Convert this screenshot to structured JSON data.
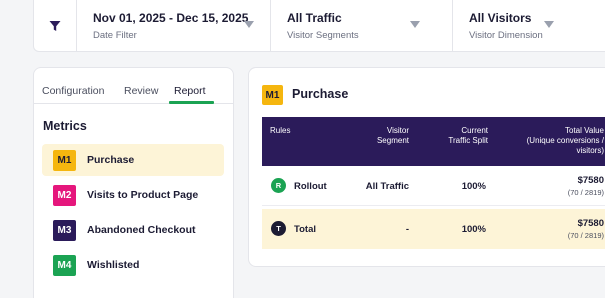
{
  "filters": [
    {
      "value": "Nov 01, 2025 - Dec 15, 2025",
      "label": "Date Filter"
    },
    {
      "value": "All Traffic",
      "label": "Visitor Segments"
    },
    {
      "value": "All Visitors",
      "label": "Visitor Dimension"
    }
  ],
  "tabs": [
    "Configuration",
    "Review",
    "Report"
  ],
  "active_tab": "Report",
  "metrics_title": "Metrics",
  "metrics": [
    {
      "code": "M1",
      "label": "Purchase",
      "color": "#f5b60f",
      "text_color": "#1c1b33",
      "active": true
    },
    {
      "code": "M2",
      "label": "Visits to Product Page",
      "color": "#e5167c",
      "text_color": "#ffffff",
      "active": false
    },
    {
      "code": "M3",
      "label": "Abandoned Checkout",
      "color": "#2b1b5a",
      "text_color": "#ffffff",
      "active": false
    },
    {
      "code": "M4",
      "label": "Wishlisted",
      "color": "#1ba353",
      "text_color": "#ffffff",
      "active": false
    }
  ],
  "report": {
    "metric_code": "M1",
    "title": "Purchase",
    "columns": {
      "rules": "Rules",
      "segment": [
        "Visitor",
        "Segment"
      ],
      "split": [
        "Current",
        "Traffic Split"
      ],
      "total": [
        "Total Value",
        "(Unique conversions /",
        "visitors)"
      ]
    },
    "rows": [
      {
        "icon": "R",
        "icon_color": "#1ba353",
        "label": "Rollout",
        "segment": "All Traffic",
        "split": "100%",
        "total": "$7580",
        "sub": "(70 / 2819)"
      },
      {
        "icon": "T",
        "icon_color": "#1c1b33",
        "label": "Total",
        "segment": "-",
        "split": "100%",
        "total": "$7580",
        "sub": "(70 / 2819)"
      }
    ]
  },
  "colors": {
    "header_bg": "#2b1b5a",
    "highlight_bg": "#fdf4d7",
    "accent_green": "#1ba353"
  },
  "icons": {
    "filter": "funnel-icon",
    "dropdown": "caret-down-icon"
  }
}
